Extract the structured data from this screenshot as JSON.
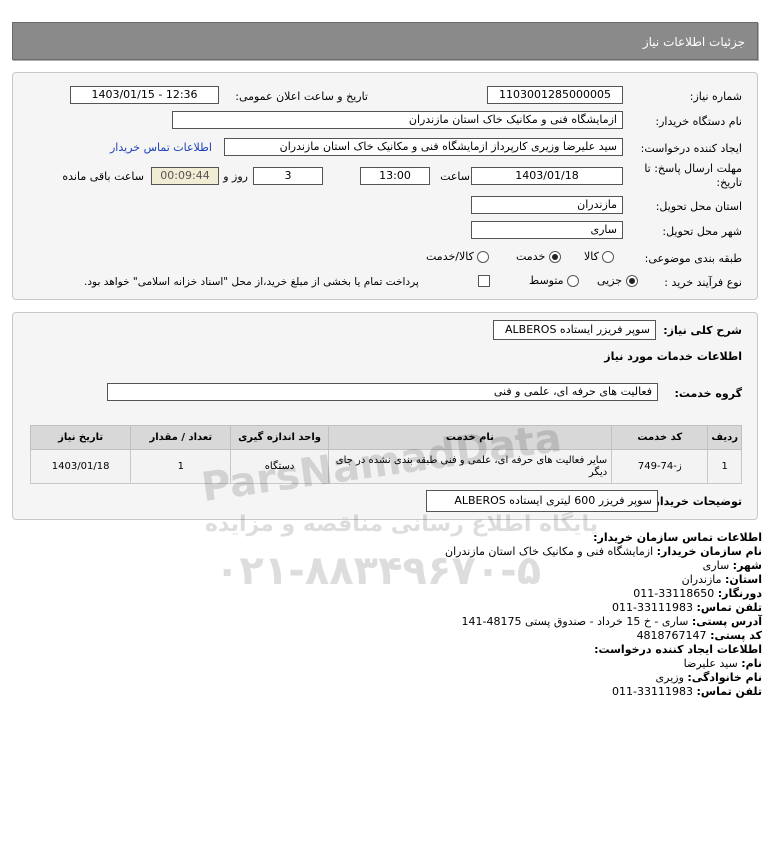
{
  "header": {
    "title": "جزئیات اطلاعات نیاز"
  },
  "form": {
    "need_number_label": "شماره نیاز:",
    "need_number": "1103001285000005",
    "announce_label": "تاریخ و ساعت اعلان عمومی:",
    "announce_value": "1403/01/15 - 12:36",
    "buyer_org_label": "نام دستگاه خریدار:",
    "buyer_org": "ازمایشگاه فنی و مکانیک خاک استان مازندران",
    "creator_label": "ایجاد کننده درخواست:",
    "creator": "سید علیرضا  وزیری  کارپرداز ازمایشگاه فنی و مکانیک خاک استان مازندران",
    "contact_link": "اطلاعات تماس خریدار",
    "deadline_label": "مهلت ارسال پاسخ: تا تاریخ:",
    "deadline_date": "1403/01/18",
    "time_label": "ساعت",
    "deadline_time": "13:00",
    "days_value": "3",
    "days_label": "روز و",
    "remaining_time": "00:09:44",
    "remaining_label": "ساعت باقی مانده",
    "province_label": "استان محل تحویل:",
    "province": "مازندران",
    "city_label": "شهر محل تحویل:",
    "city": "ساری",
    "category_label": "طبقه بندی موضوعی:",
    "category_options": [
      "کالا",
      "خدمت",
      "کالا/خدمت"
    ],
    "category_selected": "خدمت",
    "process_label": "نوع فرآیند خرید :",
    "process_options": [
      "جزیی",
      "متوسط"
    ],
    "process_selected": "جزیی",
    "payment_note": "پرداخت تمام یا بخشی از مبلغ خرید،از محل \"اسناد خزانه اسلامی\" خواهد بود."
  },
  "summary": {
    "title_label": "شرح کلی نیاز:",
    "title_value": "سوپر فریزر ایستاده ALBEROS",
    "services_heading": "اطلاعات خدمات مورد نیاز",
    "group_label": "گروه خدمت:",
    "group_value": "فعالیت های حرفه ای، علمی و فنی",
    "table": {
      "headers": [
        "ردیف",
        "کد خدمت",
        "نام خدمت",
        "واحد اندازه گیری",
        "تعداد / مقدار",
        "تاریخ نیاز"
      ],
      "rows": [
        {
          "row": "1",
          "code": "ز-74-749",
          "name": "سایر فعالیت های حرفه ای، علمی و فنی طبقه بندی نشده در جای دیگر",
          "unit": "دستگاه",
          "qty": "1",
          "date": "1403/01/18"
        }
      ]
    },
    "buyer_desc_label": "توضیحات خریدار:",
    "buyer_desc": "سوپر فریزر 600 لیتری ایستاده ALBEROS"
  },
  "contact": {
    "heading": "اطلاعات تماس سازمان خریدار:",
    "org_label": "نام سازمان خریدار:",
    "org_value": "ازمایشگاه فنی و مکانیک خاک استان مازندران",
    "city_label": "شهر:",
    "city_value": "ساری",
    "province_label": "استان:",
    "province_value": "مازندران",
    "fax_label": "دورنگار:",
    "fax_value": "33118650-011",
    "phone_label": "تلفن تماس:",
    "phone_value": "33111983-011",
    "address_label": "آدرس پستی:",
    "address_value": "ساری - خ 15 خرداد - صندوق پستی 48175-141",
    "postal_label": "کد پستی:",
    "postal_value": "4818767147",
    "creator_heading": "اطلاعات ایجاد کننده درخواست:",
    "name_label": "نام:",
    "name_value": "سید علیرضا",
    "family_label": "نام خانوادگی:",
    "family_value": "وزیری",
    "creator_phone_label": "تلفن تماس:",
    "creator_phone_value": "33111983-011"
  },
  "watermark": {
    "line1": "ParsNamadData",
    "line2": "پایگاه اطلاع رسانی مناقصه و مزایده",
    "line3": "۰۲۱-۸۸۳۴۹۶۷۰-۵"
  }
}
